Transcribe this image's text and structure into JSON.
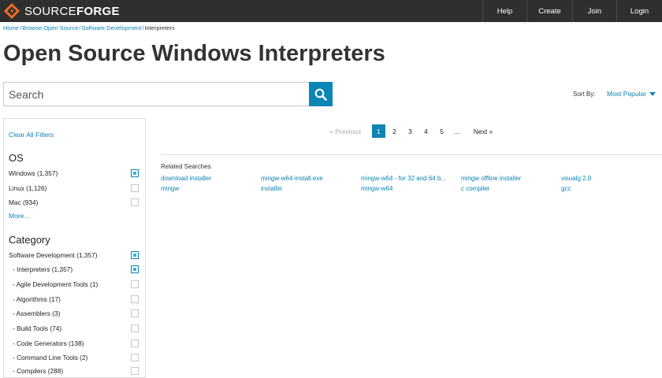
{
  "header": {
    "logo_thin": "SOURCE",
    "logo_bold": "FORGE",
    "nav": [
      "Help",
      "Create",
      "Join",
      "Login"
    ]
  },
  "breadcrumb": [
    "Home",
    "Browse Open Source",
    "Software Development",
    "Interpreters"
  ],
  "page_title": "Open Source Windows Interpreters",
  "search": {
    "placeholder": "Search"
  },
  "sort": {
    "label": "Sort By:",
    "value": "Most Popular"
  },
  "filters": {
    "clear_label": "Clear All Filters",
    "os_title": "OS",
    "os_items": [
      {
        "label": "Windows (1,357)",
        "checked": true
      },
      {
        "label": "Linux (1,126)",
        "checked": false
      },
      {
        "label": "Mac (934)",
        "checked": false
      }
    ],
    "more_label": "More...",
    "category_title": "Category",
    "category_items": [
      {
        "label": "Software Development (1,357)",
        "checked": true
      },
      {
        "label": "- Interpreters (1,357)",
        "checked": true
      },
      {
        "label": "- Agile Development Tools (1)",
        "checked": false
      },
      {
        "label": "- Algorithms (17)",
        "checked": false
      },
      {
        "label": "- Assemblers (3)",
        "checked": false
      },
      {
        "label": "- Build Tools (74)",
        "checked": false
      },
      {
        "label": "- Code Generators (138)",
        "checked": false
      },
      {
        "label": "- Command Line Tools (2)",
        "checked": false
      },
      {
        "label": "- Compilers (288)",
        "checked": false
      }
    ]
  },
  "pagination": {
    "prev": "« Previous",
    "pages": [
      "1",
      "2",
      "3",
      "4",
      "5"
    ],
    "active": "1",
    "ellipsis": "...",
    "next": "Next »"
  },
  "related": {
    "title": "Related Searches",
    "links": [
      "download installer",
      "mingw-w64-install.exe",
      "mingw-w64 - for 32 and 64 b...",
      "mingw offline installer",
      "visualg 2.0",
      "mingw",
      "installer",
      "mingw-w64",
      "c compiler",
      "gcc"
    ]
  },
  "colors": {
    "accent": "#0a85b5",
    "header_bg": "#2f2f2f",
    "logo_orange": "#f26c22"
  },
  "icons": {
    "logo": "sourceforge-diamond-icon",
    "search": "search-icon",
    "sort": "caret-down-icon"
  }
}
